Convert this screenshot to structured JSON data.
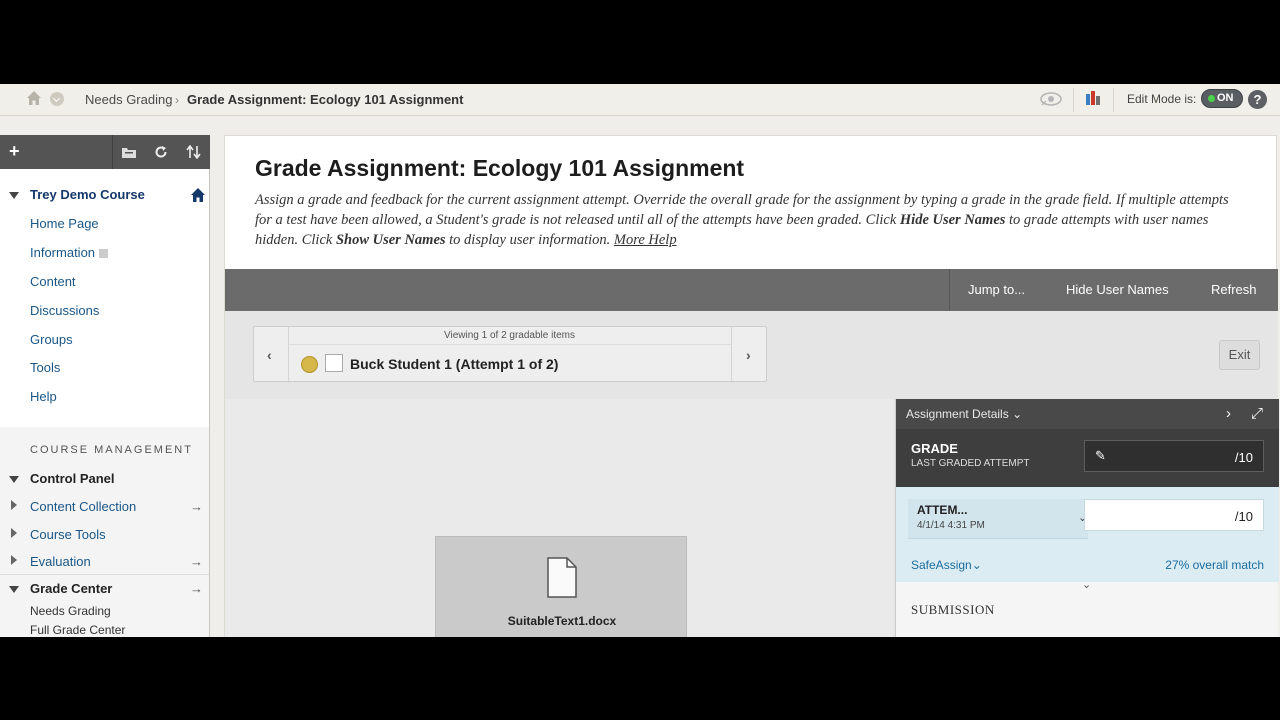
{
  "topbar": {
    "breadcrumb_1": "Needs Grading",
    "breadcrumb_sep": "›",
    "breadcrumb_2": "Grade Assignment: Ecology 101 Assignment",
    "edit_mode_label": "Edit Mode is:",
    "edit_mode_value": "ON",
    "help_label": "?"
  },
  "sidebar": {
    "course_title": "Trey Demo Course",
    "items": [
      {
        "label": "Home Page"
      },
      {
        "label": "Information"
      },
      {
        "label": "Content"
      },
      {
        "label": "Discussions"
      },
      {
        "label": "Groups"
      },
      {
        "label": "Tools"
      },
      {
        "label": "Help"
      }
    ],
    "course_management_label": "COURSE MANAGEMENT",
    "control_panel": "Control Panel",
    "cm_items": [
      {
        "label": "Content Collection"
      },
      {
        "label": "Course Tools"
      },
      {
        "label": "Evaluation"
      }
    ],
    "grade_center": "Grade Center",
    "grade_center_items": [
      {
        "label": "Needs Grading"
      },
      {
        "label": "Full Grade Center"
      }
    ]
  },
  "main": {
    "title": "Grade Assignment: Ecology 101 Assignment",
    "desc_1": "Assign a grade and feedback for the current assignment attempt. Override the overall grade for the assignment by typing a grade in the grade field. If multiple attempts for a test have been allowed, a Student's grade is not released until all of the attempts have been graded. Click ",
    "desc_hide": "Hide User Names",
    "desc_2": " to grade attempts with user names hidden. Click ",
    "desc_show": "Show User Names",
    "desc_3": " to display user information. ",
    "desc_more": "More Help",
    "actions": {
      "jump": "Jump to...",
      "hide": "Hide User Names",
      "refresh": "Refresh"
    },
    "viewing": "Viewing 1 of 2 gradable items",
    "student": "Buck Student 1 (Attempt 1 of 2)",
    "exit": "Exit",
    "file_name": "SuitableText1.docx"
  },
  "details": {
    "title": "Assignment Details",
    "grade_label": "GRADE",
    "grade_sub": "LAST GRADED ATTEMPT",
    "grade_out_of": "/10",
    "attempt_label": "ATTEM...",
    "attempt_date": "4/1/14 4:31 PM",
    "attempt_out_of": "/10",
    "safeassign": "SafeAssign",
    "match": "27% overall match",
    "submission": "SUBMISSION"
  },
  "colors": {
    "link": "#1a5788",
    "toggle_on": "#4cd14c",
    "status_dot": "#d6b84a"
  }
}
